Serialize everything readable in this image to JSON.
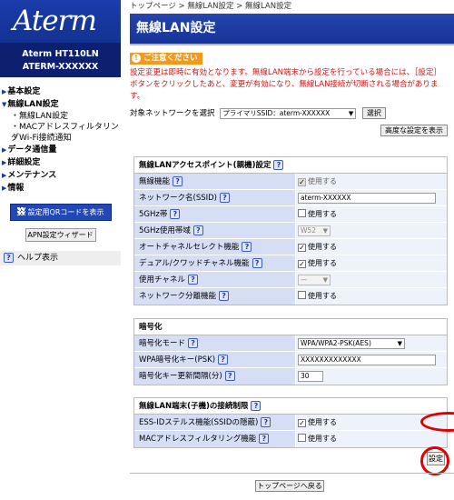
{
  "sidebar": {
    "logo": "Aterm",
    "model_line1": "Aterm   HT110LN",
    "model_line2": "ATERM-XXXXXX",
    "menu": [
      {
        "label": "基本設定",
        "type": "top"
      },
      {
        "label": "無線LAN設定",
        "type": "top"
      },
      {
        "label": "・無線LAN設定",
        "type": "sub"
      },
      {
        "label": "・MACアドレスフィルタリング",
        "type": "sub"
      },
      {
        "label": "・Wi-Fi接続通知",
        "type": "sub"
      },
      {
        "label": "データ通信量",
        "type": "top"
      },
      {
        "label": "詳細設定",
        "type": "top"
      },
      {
        "label": "メンテナンス",
        "type": "top"
      },
      {
        "label": "情報",
        "type": "top"
      }
    ],
    "qr_button": "設定用QRコードを表示",
    "apn_button": "APN設定ウィザード",
    "help_label": "ヘルプ表示",
    "help_icon": "?"
  },
  "breadcrumb": "トップページ > 無線LAN設定 > 無線LAN設定",
  "title": "無線LAN設定",
  "notice": {
    "badge": "ご注意ください",
    "text": "設定変更は即時に有効となります。無線LAN端末から設定を行っている場合には、［設定］ボタンをクリックしたあと、変更が有効になり、無線LAN接続が切断される場合があります。"
  },
  "target": {
    "label": "対象ネットワークを選択",
    "selected": "プライマリSSID：aterm-XXXXXX",
    "select_button": "選択"
  },
  "advanced_button": "高度な設定を表示",
  "sections": {
    "ap": {
      "title": "無線LANアクセスポイント(親機)設定",
      "rows": {
        "wireless": {
          "label": "無線機能",
          "value": "使用する",
          "checked": true,
          "disabled": true
        },
        "ssid": {
          "label": "ネットワーク名(SSID)",
          "value": "aterm-XXXXXX"
        },
        "band5": {
          "label": "5GHz帯",
          "value": "使用する",
          "checked": false
        },
        "band5_ch": {
          "label": "5GHz使用帯域",
          "value": "W52"
        },
        "auto_ch": {
          "label": "オートチャネルセレクト機能",
          "value": "使用する",
          "checked": true
        },
        "dual": {
          "label": "デュアル/クワッドチャネル機能",
          "value": "使用する",
          "checked": true
        },
        "channel": {
          "label": "使用チャネル",
          "value": "—"
        },
        "sep": {
          "label": "ネットワーク分離機能",
          "value": "使用する",
          "checked": false
        }
      }
    },
    "enc": {
      "title": "暗号化",
      "rows": {
        "mode": {
          "label": "暗号化モード",
          "value": "WPA/WPA2-PSK(AES)"
        },
        "key": {
          "label": "WPA暗号化キー(PSK)",
          "value": "XXXXXXXXXXXXX"
        },
        "interval": {
          "label": "暗号化キー更新間隔(分)",
          "value": "30"
        }
      }
    },
    "client": {
      "title": "無線LAN端末(子機)の接続制限",
      "rows": {
        "stealth": {
          "label": "ESS-IDステルス機能(SSIDの隠蔽)",
          "value": "使用する",
          "checked": true
        },
        "macfilter": {
          "label": "MACアドレスフィルタリング機能",
          "value": "使用する",
          "checked": false
        }
      }
    }
  },
  "set_button": "設定",
  "back_button": "トップページへ戻る",
  "colors": {
    "brand": "#1b3caa",
    "notice": "#d21414",
    "highlight": "#e00000"
  }
}
